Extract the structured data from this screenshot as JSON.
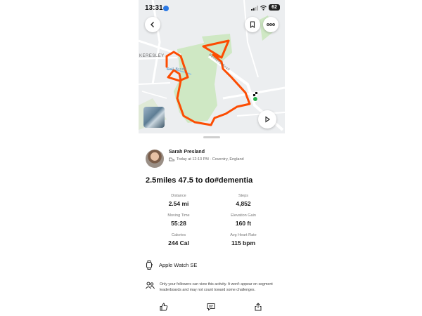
{
  "status_bar": {
    "time": "13:31",
    "battery": "62"
  },
  "map": {
    "place_label": "KERESLEY",
    "water_label": "Coll Brook",
    "road_label": "Bennetts Road",
    "route_color": "#fc4c02",
    "finish_dot_color": "#27b04c",
    "icons": [
      "back-icon",
      "bookmark-icon",
      "more-icon",
      "play-icon"
    ]
  },
  "activity": {
    "athlete_name": "Sarah Presland",
    "meta": "Today at 12:13 PM · Coventry, England",
    "title": "2.5miles 47.5 to do#dementia",
    "stats": [
      {
        "label": "Distance",
        "value": "2.54 mi"
      },
      {
        "label": "Steps",
        "value": "4,852"
      },
      {
        "label": "Moving Time",
        "value": "55:28"
      },
      {
        "label": "Elevation Gain",
        "value": "160 ft"
      },
      {
        "label": "Calories",
        "value": "244 Cal"
      },
      {
        "label": "Avg Heart Rate",
        "value": "115 bpm"
      }
    ],
    "device": "Apple Watch SE",
    "privacy_note": "Only your followers can view this activity. It won't appear on segment leaderboards and may not count toward some challenges."
  },
  "action_bar": {
    "icons": [
      "kudos-icon",
      "comment-icon",
      "share-icon"
    ]
  }
}
